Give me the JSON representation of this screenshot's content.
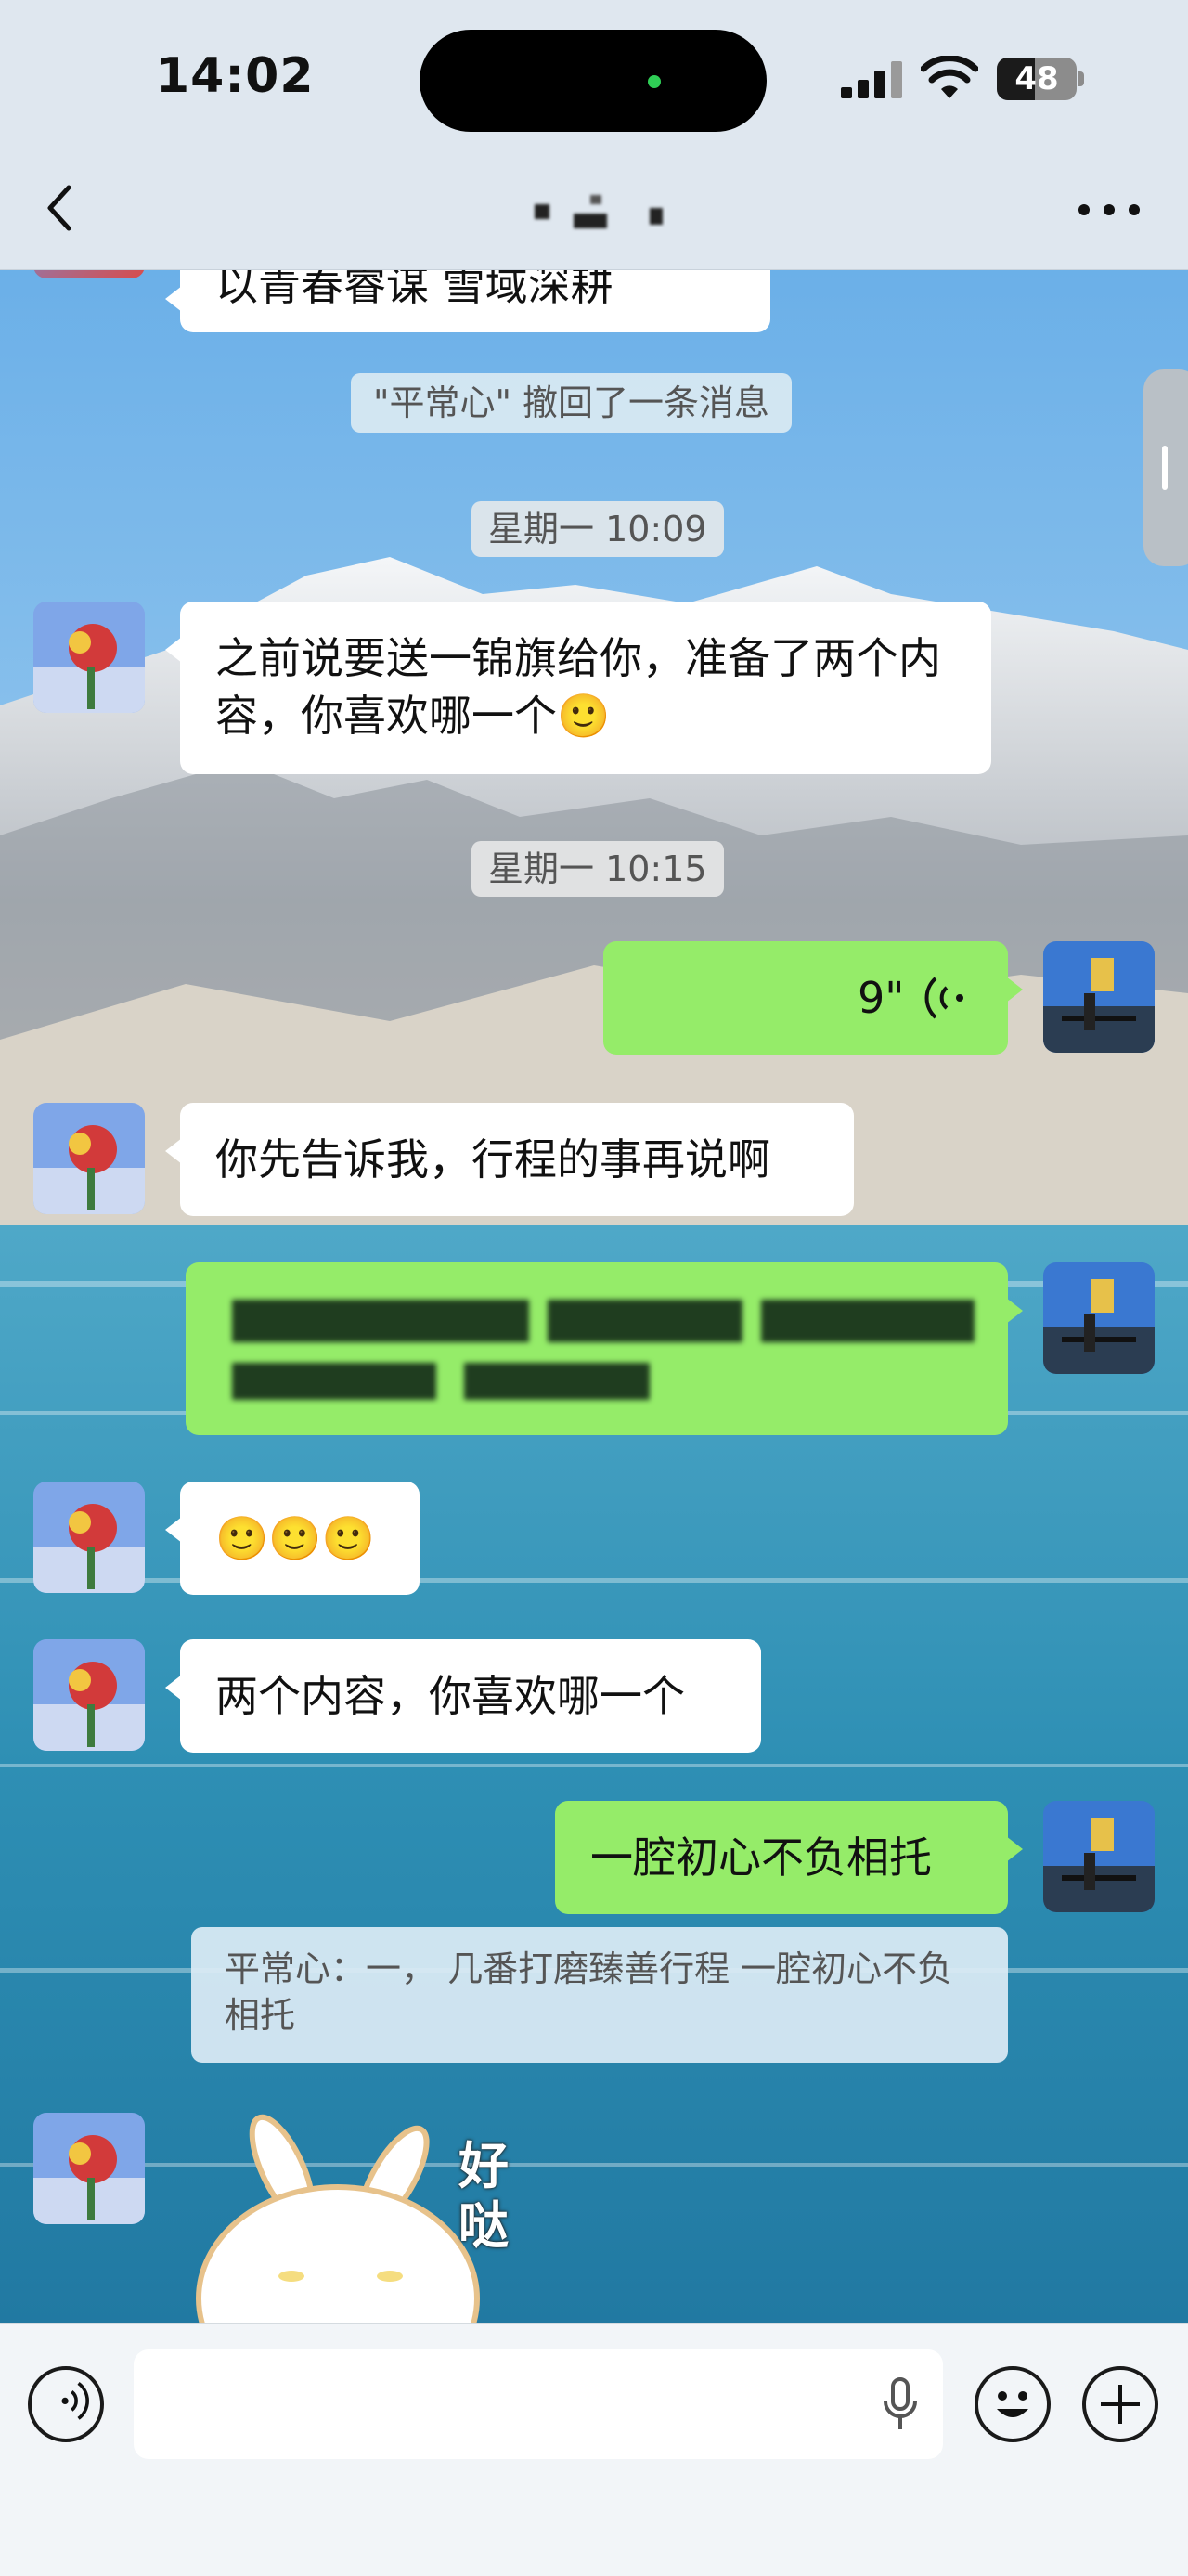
{
  "status": {
    "time": "14:02",
    "battery": "48",
    "battery_level": 0.48
  },
  "nav": {
    "back_icon": "chevron-left-icon",
    "more_icon": "ellipsis-icon"
  },
  "messages": {
    "m0": {
      "text": "以青春睿谋 雪域深耕"
    },
    "recall": {
      "text": "\"平常心\" 撤回了一条消息"
    },
    "t1": {
      "text": "星期一 10:09"
    },
    "m1": {
      "text": "之前说要送一锦旗给你，准备了两个内容，你喜欢哪一个",
      "emoji": "🙂"
    },
    "t2": {
      "text": "星期一 10:15"
    },
    "voice": {
      "duration": "9\"",
      "icon": "voice-wave-icon"
    },
    "m2": {
      "text": "你先告诉我，行程的事再说啊"
    },
    "m3": {
      "emoji": "🙂🙂🙂"
    },
    "m4": {
      "text": "两个内容，你喜欢哪一个"
    },
    "m5": {
      "text": "一腔初心不负相托"
    },
    "quote": {
      "text": "平常心：一，  几番打磨臻善行程 一腔初心不负相托"
    },
    "sticker": {
      "text": "好哒"
    }
  },
  "input": {
    "voice_icon": "voice-mode-icon",
    "mic_icon": "microphone-icon",
    "emoji_icon": "emoji-icon",
    "plus_icon": "plus-icon"
  }
}
